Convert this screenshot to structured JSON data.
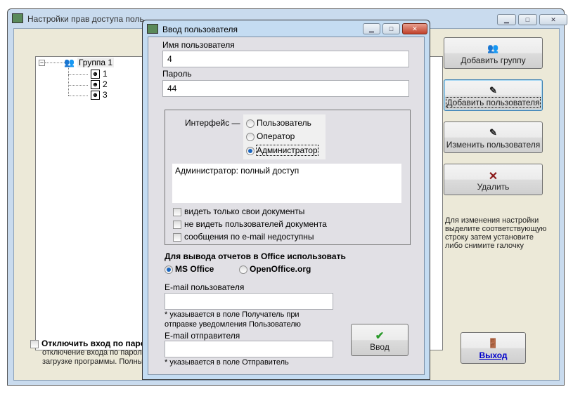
{
  "main_window": {
    "title": "Настройки прав доступа поль",
    "tree": {
      "group": "Группа 1",
      "users": [
        "1",
        "2",
        "3"
      ]
    },
    "buttons": {
      "add_group": "Добавить группу",
      "add_user": "Добавить пользователя",
      "edit_user": "Изменить пользователя",
      "delete": "Удалить",
      "exit": "Выход"
    },
    "hint": [
      "Для изменения настройки",
      "выделите соответствующую",
      "строку затем установите",
      "либо снимите галочку"
    ],
    "disable_login": {
      "label": "Отключить вход по паро",
      "desc1": "отключение входа по паролю",
      "desc2": "загрузке программы. Полны",
      "checked": false
    }
  },
  "dialog": {
    "title": "Ввод пользователя",
    "username_label": "Имя пользователя",
    "username_value": "4",
    "password_label": "Пароль",
    "password_value": "44",
    "interface_label": "Интерфейс —",
    "interface_options": [
      "Пользователь",
      "Оператор",
      "Администратор"
    ],
    "interface_selected": "Администратор",
    "description": "Администратор: полный доступ",
    "checkboxes": [
      "видеть только свои документы",
      "не видеть пользователей документа",
      "сообщения по e-mail недоступны"
    ],
    "office_label": "Для вывода отчетов в Office использовать",
    "office_options": [
      "MS Office",
      "OpenOffice.org"
    ],
    "office_selected": "MS Office",
    "email_user_label": "E-mail пользователя",
    "email_user_value": "",
    "email_user_note1": "* указывается в поле Получатель при",
    "email_user_note2": "отправке уведомления Пользователю",
    "email_sender_label": "E-mail отправителя",
    "email_sender_value": "",
    "email_sender_note": "* указывается в поле Отправитель",
    "enter_button": "Ввод"
  },
  "colors": {
    "delete_icon": "#8b1a1a",
    "check_icon": "#2a9a2a",
    "link": "#0000cc"
  }
}
